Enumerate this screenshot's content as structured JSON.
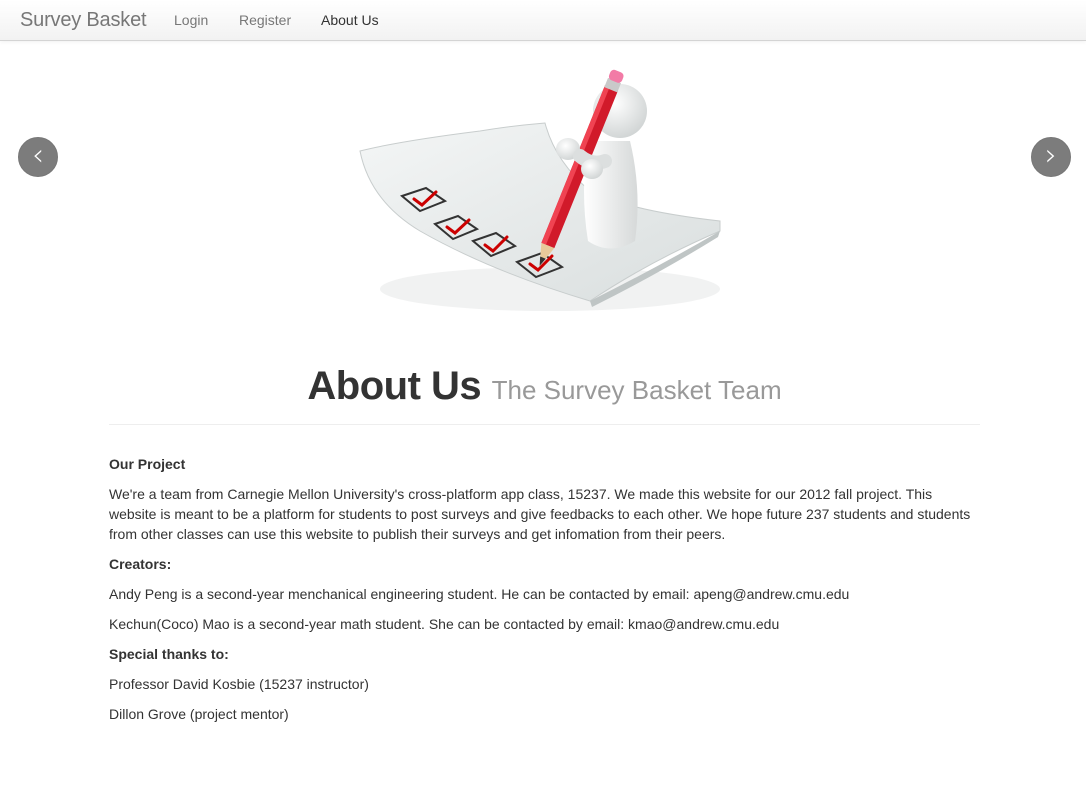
{
  "navbar": {
    "brand": "Survey Basket",
    "links": [
      {
        "label": "Login"
      },
      {
        "label": "Register"
      },
      {
        "label": "About Us"
      }
    ]
  },
  "carousel": {
    "prev_icon": "chevron-left-icon",
    "next_icon": "chevron-right-icon",
    "prev_glyph": "‹",
    "next_glyph": "›"
  },
  "header": {
    "title": "About Us",
    "subtitle": "The Survey Basket Team"
  },
  "content": {
    "project_heading": "Our Project",
    "project_text": "We're a team from Carnegie Mellon University's cross-platform app class, 15237. We made this website for our 2012 fall project. This website is meant to be a platform for students to post surveys and give feedbacks to each other. We hope future 237 students and students from other classes can use this website to publish their surveys and get infomation from their peers.",
    "creators_heading": "Creators:",
    "creator_1": "Andy Peng is a second-year menchanical engineering student. He can be contacted by email: apeng@andrew.cmu.edu",
    "creator_2": "Kechun(Coco) Mao is a second-year math student. She can be contacted by email: kmao@andrew.cmu.edu",
    "thanks_heading": "Special thanks to:",
    "thanks_1": "Professor David Kosbie (15237 instructor)",
    "thanks_2": "Dillon Grove (project mentor)"
  },
  "colors": {
    "nav_text": "#777777",
    "nav_active": "#333333",
    "subtitle": "#999999",
    "carousel_control": "#7c7c7c",
    "checkmark": "#cc0000"
  }
}
